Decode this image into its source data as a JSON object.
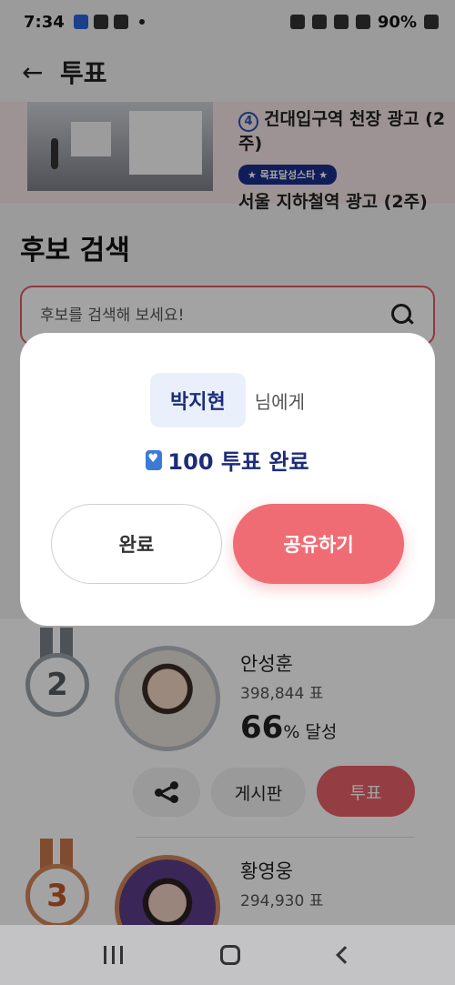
{
  "status_bar": {
    "time": "7:34",
    "battery": "90%"
  },
  "header": {
    "title": "투표"
  },
  "banner": {
    "item_number": "4",
    "line1": "건대입구역 천장 광고 (2주)",
    "badge": "★ 목표달성스타 ★",
    "line3": "서울 지하철역 광고 (2주)"
  },
  "search": {
    "section_title": "후보 검색",
    "placeholder": "후보를 검색해 보세요!"
  },
  "candidates": [
    {
      "rank": "2",
      "name": "안성훈",
      "votes": "398,844 표",
      "percent": "66",
      "percent_suffix": "% 달성"
    },
    {
      "rank": "3",
      "name": "황영웅",
      "votes": "294,930 표"
    }
  ],
  "actions": {
    "board": "게시판",
    "vote": "투표"
  },
  "modal": {
    "recipient": "박지현",
    "recipient_suffix": "님에게",
    "result": "100 투표 완료",
    "done_button": "완료",
    "share_button": "공유하기"
  }
}
